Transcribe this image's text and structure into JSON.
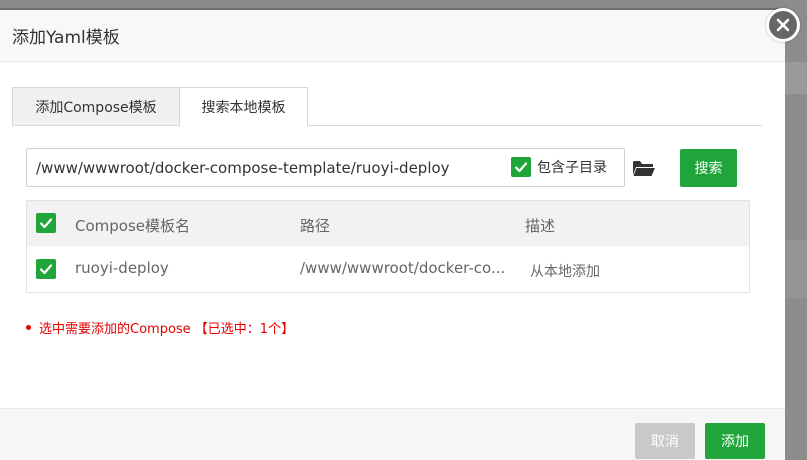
{
  "dialog": {
    "title": "添加Yaml模板"
  },
  "tabs": [
    {
      "label": "添加Compose模板",
      "active": false
    },
    {
      "label": "搜索本地模板",
      "active": true
    }
  ],
  "search": {
    "path_value": "/www/wwwroot/docker-compose-template/ruoyi-deploy",
    "include_subdir_label": "包含子目录",
    "include_subdir_checked": true,
    "folder_icon": "folder-open-icon",
    "button_label": "搜索"
  },
  "table": {
    "headers": {
      "name": "Compose模板名",
      "path": "路径",
      "desc": "描述"
    },
    "rows": [
      {
        "checked": true,
        "name": "ruoyi-deploy",
        "path": "/www/wwwroot/docker-co...",
        "desc": "从本地添加"
      }
    ]
  },
  "note": {
    "text": "选中需要添加的Compose 【已选中：1个】"
  },
  "footer": {
    "cancel_label": "取消",
    "add_label": "添加"
  },
  "colors": {
    "accent": "#20a53a",
    "note": "#e60000",
    "disabled": "#c9c9c9"
  }
}
